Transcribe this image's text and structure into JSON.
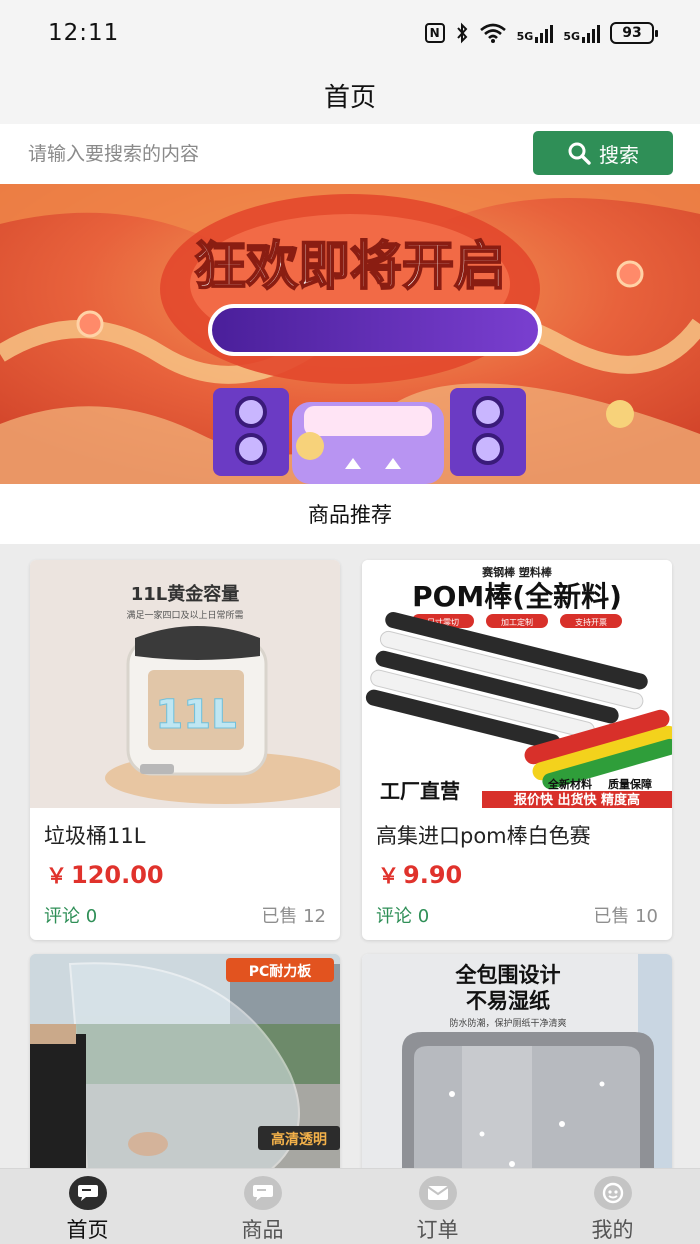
{
  "status_bar": {
    "time": "12:11",
    "network_1": "5G",
    "network_2": "5G",
    "battery": "93",
    "icons": [
      "nfc-icon",
      "bluetooth-icon",
      "wifi-icon",
      "signal-icon",
      "signal-icon",
      "battery-icon"
    ]
  },
  "header": {
    "title": "首页"
  },
  "search": {
    "placeholder": "请输入要搜索的内容",
    "button_label": "搜索",
    "accent": "#2f8f57"
  },
  "banner": {
    "headline": "狂欢即将开启"
  },
  "section": {
    "title": "商品推荐"
  },
  "products": [
    {
      "name": "垃圾桶11L",
      "price": "120.00",
      "currency": "￥",
      "comments": "评论 0",
      "sold": "已售 12",
      "image_text": {
        "line1": "11L黄金容量",
        "line2": "满足一家四口及以上日常所需",
        "big": "11L"
      }
    },
    {
      "name": "高集进口pom棒白色赛",
      "price": "9.90",
      "currency": "￥",
      "comments": "评论 0",
      "sold": "已售 10",
      "image_text": {
        "top": "赛钢棒 塑料棒",
        "title": "POM棒(全新料)",
        "tag1": "尺寸零切",
        "tag2": "加工定制",
        "tag3": "支持开票",
        "factory": "工厂直营",
        "sub1": "全新材料",
        "sub2": "质量保障",
        "bar": "报价快 出货快 精度高"
      }
    },
    {
      "image_text": {
        "badge": "PC耐力板",
        "bottom": "高清透明"
      }
    },
    {
      "image_text": {
        "line1": "全包围设计",
        "line2": "不易湿纸",
        "line3": "防水防潮，保护厕纸干净清爽"
      }
    }
  ],
  "nav": [
    {
      "label": "首页",
      "icon": "home-chat-icon",
      "active": true
    },
    {
      "label": "商品",
      "icon": "goods-icon",
      "active": false
    },
    {
      "label": "订单",
      "icon": "order-mail-icon",
      "active": false
    },
    {
      "label": "我的",
      "icon": "profile-icon",
      "active": false
    }
  ],
  "colors": {
    "price": "#e0322c",
    "comments": "#2f8f57",
    "nav_active": "#2d2d2d"
  }
}
